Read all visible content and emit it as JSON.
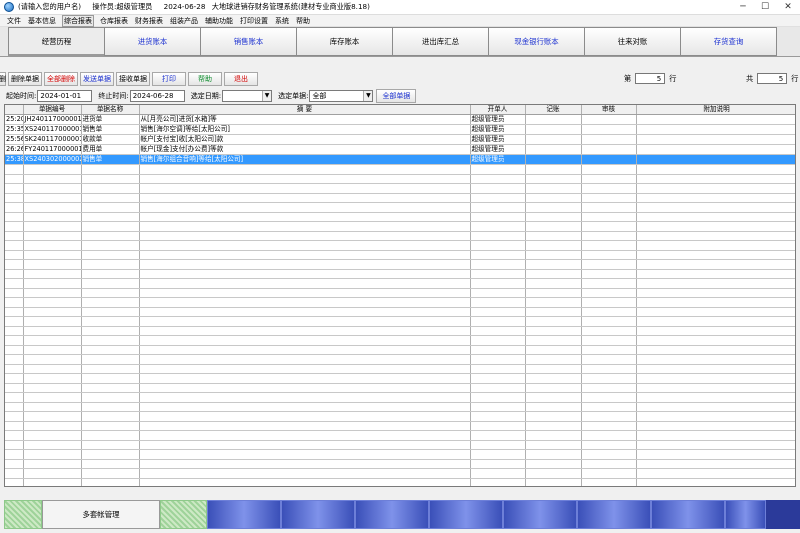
{
  "window": {
    "user": "(请输入您的用户名)",
    "operator": "操作员:超级管理员",
    "date": "2024-06-28",
    "app_title": "大地球进销存财务管理系统(建材专业商业版8.18)",
    "minimize": "─",
    "maximize": "☐",
    "close": "✕"
  },
  "menu": [
    "文件",
    "基本信息",
    "综合报表",
    "仓库报表",
    "财务报表",
    "组装产品",
    "辅助功能",
    "打印设置",
    "系统",
    "帮助"
  ],
  "tabs": [
    "经营历程",
    "进货账本",
    "销售账本",
    "库存账本",
    "进出库汇总",
    "现金银行账本",
    "往来对账",
    "存货查询"
  ],
  "toolbar": {
    "cut_prefix": "删",
    "delete": "删除单据",
    "delete_all": "全部删除",
    "send": "发送单据",
    "receive": "接收单据",
    "print": "打印",
    "help": "帮助",
    "exit": "退出",
    "page_label": "第",
    "page_value": "5",
    "page_unit": "行",
    "total_label": "共",
    "total_value": "5",
    "total_unit": "行"
  },
  "filter": {
    "start_label": "起始时间:",
    "start_value": "2024-01-01",
    "end_label": "终止时间:",
    "end_value": "2024-06-28",
    "date_label": "选定日期:",
    "date_value": "",
    "doc_label": "选定单据:",
    "doc_value": "全部",
    "all_button": "全部单据"
  },
  "grid": {
    "headers": [
      "",
      "单据编号",
      "单据名称",
      "摘 要",
      "开单人",
      "记账",
      "审核",
      "附加说明"
    ],
    "rows": [
      [
        "25:20",
        "JH240117000001",
        "进货单",
        "从[月亮公司]进货[水箱]等",
        "超级管理员",
        "",
        "",
        ""
      ],
      [
        "25:35",
        "XS240117000001",
        "销售单",
        "销售[海尔空调]等给[太阳公司]",
        "超级管理员",
        "",
        "",
        ""
      ],
      [
        "25:56",
        "SK240117000001",
        "收款单",
        "帐户[支付宝]收[太阳公司]款",
        "超级管理员",
        "",
        "",
        ""
      ],
      [
        "26:26",
        "FY240117000001",
        "费用单",
        "帐户[现金]支付[办公费]等款",
        "超级管理员",
        "",
        "",
        ""
      ],
      [
        "25:38",
        "XS240302000002",
        "销售单",
        "销售[海尔组合音响]等给[太阳公司]",
        "超级管理员",
        "",
        "",
        ""
      ]
    ],
    "selected_row": 4
  },
  "bottom": {
    "active_label": "多套帐管理"
  }
}
